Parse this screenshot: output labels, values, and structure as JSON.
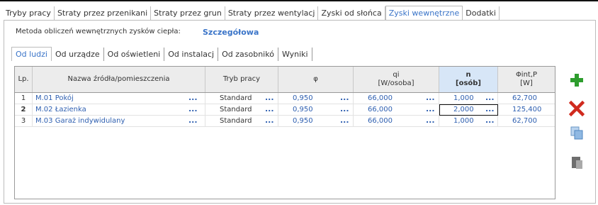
{
  "main_tabs": [
    {
      "label": "Tryby pracy"
    },
    {
      "label": "Straty przez przenikani"
    },
    {
      "label": "Straty przez grun"
    },
    {
      "label": "Straty przez wentylacj"
    },
    {
      "label": "Zyski od słońca"
    },
    {
      "label": "Zyski wewnętrzne"
    },
    {
      "label": "Dodatki"
    }
  ],
  "active_main_tab": "Zyski wewnętrzne",
  "method": {
    "label": "Metoda obliczeń wewnętrznych zysków ciepła:",
    "value": "Szczegółowa"
  },
  "sub_tabs": [
    {
      "label": "Od ludzi"
    },
    {
      "label": "Od urządze"
    },
    {
      "label": "Od oświetleni"
    },
    {
      "label": "Od instalacj"
    },
    {
      "label": "Od zasobnikó"
    },
    {
      "label": "Wyniki"
    }
  ],
  "active_sub_tab": "Od ludzi",
  "table": {
    "headers": {
      "lp": "Lp.",
      "name": "Nazwa źródła/pomieszczenia",
      "mode": "Tryb pracy",
      "phi": "φ",
      "qi_line1": "qi",
      "qi_line2": "[W/osoba]",
      "n_line1": "n",
      "n_line2": "[osób]",
      "pint_line1": "Φint,P",
      "pint_line2": "[W]"
    },
    "rows": [
      {
        "lp": "1",
        "name": "M.01 Pokój",
        "mode": "Standard",
        "phi": "0,950",
        "qi": "66,000",
        "n": "1,000",
        "pint": "62,700"
      },
      {
        "lp": "2",
        "name": "M.02 Łazienka",
        "mode": "Standard",
        "phi": "0,950",
        "qi": "66,000",
        "n": "2,000",
        "pint": "125,400"
      },
      {
        "lp": "3",
        "name": "M.03 Garaż indywidulany",
        "mode": "Standard",
        "phi": "0,950",
        "qi": "66,000",
        "n": "1,000",
        "pint": "62,700"
      }
    ],
    "ellipsis": "..."
  },
  "side_buttons": [
    {
      "icon": "plus-icon"
    },
    {
      "icon": "delete-x-icon"
    },
    {
      "icon": "copy-icon"
    },
    {
      "icon": "paste-icon"
    }
  ],
  "colors": {
    "accent": "#3a74c8",
    "link": "#2e5fb0",
    "plus": "#2e9d2e",
    "delete": "#d02a1e"
  }
}
